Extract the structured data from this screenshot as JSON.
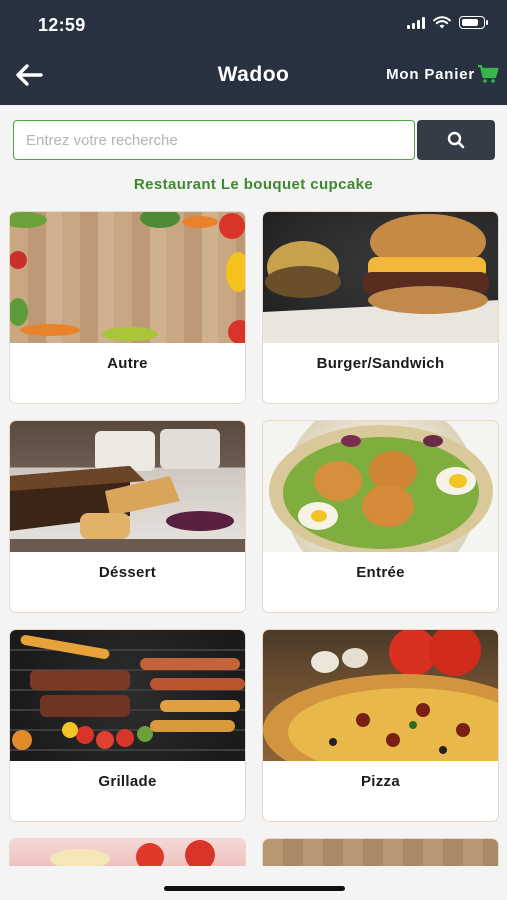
{
  "status": {
    "time": "12:59"
  },
  "header": {
    "title": "Wadoo",
    "cart_label": "Mon  Panier"
  },
  "search": {
    "placeholder": "Entrez votre recherche"
  },
  "restaurant": {
    "name": "Restaurant Le bouquet cupcake"
  },
  "categories": [
    {
      "label": "Autre"
    },
    {
      "label": "Burger/Sandwich"
    },
    {
      "label": "Déssert"
    },
    {
      "label": "Entrée"
    },
    {
      "label": "Grillade"
    },
    {
      "label": "Pizza"
    }
  ],
  "colors": {
    "header_bg": "#273140",
    "accent_green": "#3d8a2e",
    "search_button": "#343c48"
  }
}
